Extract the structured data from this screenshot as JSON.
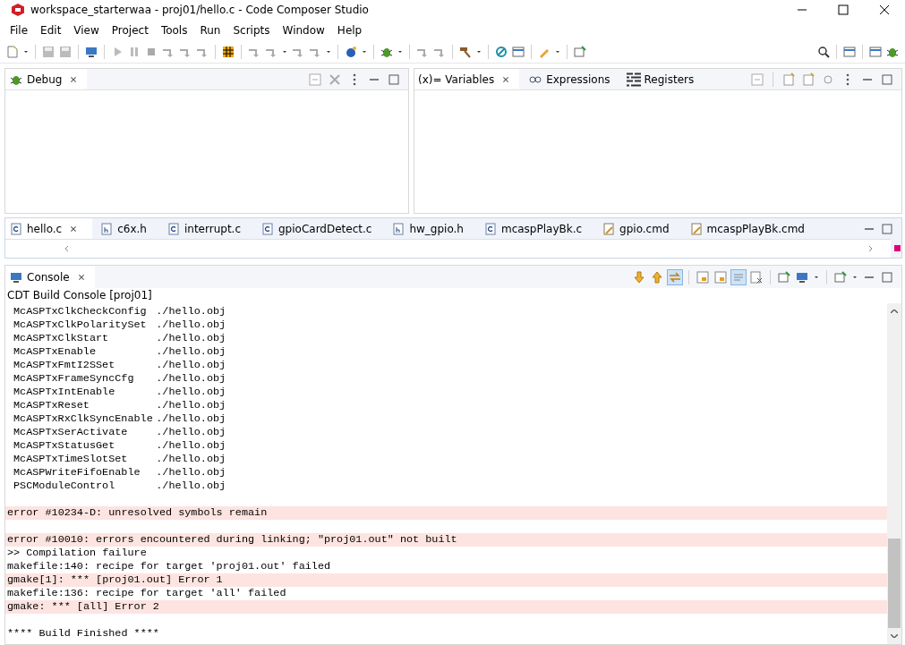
{
  "window": {
    "title": "workspace_starterwaa - proj01/hello.c - Code Composer Studio"
  },
  "menu": [
    "File",
    "Edit",
    "View",
    "Project",
    "Tools",
    "Run",
    "Scripts",
    "Window",
    "Help"
  ],
  "debug_view": {
    "tabs": [
      {
        "label": "Debug",
        "selected": true
      }
    ]
  },
  "variables_view": {
    "tabs": [
      {
        "label": "(x)= Variables",
        "selected": true
      },
      {
        "label": "Expressions",
        "selected": false
      },
      {
        "label": "Registers",
        "selected": false
      }
    ]
  },
  "editor_tabs": [
    {
      "label": "hello.c",
      "selected": true,
      "kind": "c"
    },
    {
      "label": "c6x.h",
      "selected": false,
      "kind": "h"
    },
    {
      "label": "interrupt.c",
      "selected": false,
      "kind": "c"
    },
    {
      "label": "gpioCardDetect.c",
      "selected": false,
      "kind": "c"
    },
    {
      "label": "hw_gpio.h",
      "selected": false,
      "kind": "h"
    },
    {
      "label": "mcaspPlayBk.c",
      "selected": false,
      "kind": "c"
    },
    {
      "label": "gpio.cmd",
      "selected": false,
      "kind": "cmd"
    },
    {
      "label": "mcaspPlayBk.cmd",
      "selected": false,
      "kind": "cmd"
    }
  ],
  "console": {
    "tab": {
      "label": "Console",
      "selected": true
    },
    "subtitle": "CDT Build Console [proj01]",
    "lines": [
      {
        "kind": "symbol",
        "symbol": "McASPTxClkCheckConfig",
        "file": "./hello.obj"
      },
      {
        "kind": "symbol",
        "symbol": "McASPTxClkPolaritySet",
        "file": "./hello.obj"
      },
      {
        "kind": "symbol",
        "symbol": "McASPTxClkStart",
        "file": "./hello.obj"
      },
      {
        "kind": "symbol",
        "symbol": "McASPTxEnable",
        "file": "./hello.obj"
      },
      {
        "kind": "symbol",
        "symbol": "McASPTxFmtI2SSet",
        "file": "./hello.obj"
      },
      {
        "kind": "symbol",
        "symbol": "McASPTxFrameSyncCfg",
        "file": "./hello.obj"
      },
      {
        "kind": "symbol",
        "symbol": "McASPTxIntEnable",
        "file": "./hello.obj"
      },
      {
        "kind": "symbol",
        "symbol": "McASPTxReset",
        "file": "./hello.obj"
      },
      {
        "kind": "symbol",
        "symbol": "McASPTxRxClkSyncEnable",
        "file": "./hello.obj"
      },
      {
        "kind": "symbol",
        "symbol": "McASPTxSerActivate",
        "file": "./hello.obj"
      },
      {
        "kind": "symbol",
        "symbol": "McASPTxStatusGet",
        "file": "./hello.obj"
      },
      {
        "kind": "symbol",
        "symbol": "McASPTxTimeSlotSet",
        "file": "./hello.obj"
      },
      {
        "kind": "symbol",
        "symbol": "McASPWriteFifoEnable",
        "file": "./hello.obj"
      },
      {
        "kind": "symbol",
        "symbol": "PSCModuleControl",
        "file": "./hello.obj"
      },
      {
        "kind": "blank"
      },
      {
        "kind": "text",
        "text": "error #10234-D: unresolved symbols remain",
        "highlighted": true
      },
      {
        "kind": "blank"
      },
      {
        "kind": "text",
        "text": "error #10010: errors encountered during linking; \"proj01.out\" not built",
        "highlighted": true
      },
      {
        "kind": "text",
        "text": ">> Compilation failure",
        "highlighted": false
      },
      {
        "kind": "text",
        "text": "makefile:140: recipe for target 'proj01.out' failed",
        "highlighted": false
      },
      {
        "kind": "text",
        "text": "gmake[1]: *** [proj01.out] Error 1",
        "highlighted": true
      },
      {
        "kind": "text",
        "text": "makefile:136: recipe for target 'all' failed",
        "highlighted": false
      },
      {
        "kind": "text",
        "text": "gmake: *** [all] Error 2",
        "highlighted": true
      },
      {
        "kind": "blank"
      },
      {
        "kind": "text",
        "text": "**** Build Finished ****",
        "highlighted": false
      }
    ]
  }
}
